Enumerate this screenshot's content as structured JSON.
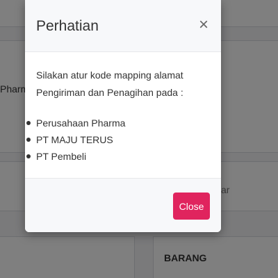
{
  "background": {
    "partial_text_left": "Pharm",
    "partial_text_right": "ar",
    "section_label": "BARANG"
  },
  "modal": {
    "title": "Perhatian",
    "close_icon": "close-icon",
    "message": "Silakan atur kode mapping alamat Pengiriman dan Penagihan pada :",
    "items": [
      "Perusahaan Pharma",
      "PT MAJU TERUS",
      "PT Pembeli"
    ],
    "close_button_label": "Close"
  },
  "colors": {
    "primary_button": "#e0245e",
    "backdrop": "rgba(0,0,0,0.5)"
  }
}
